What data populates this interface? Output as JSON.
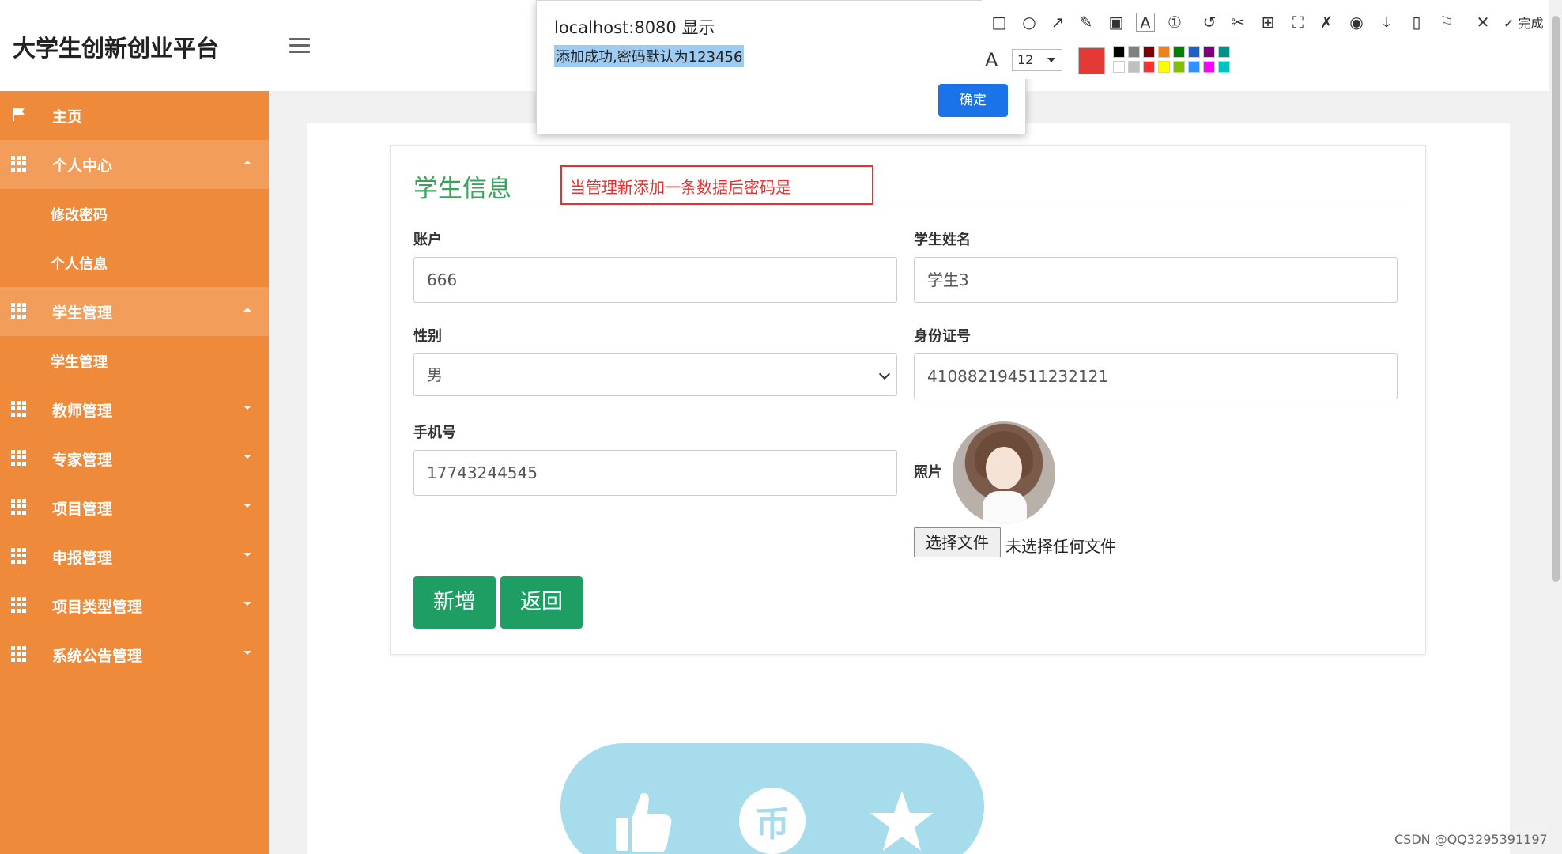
{
  "header": {
    "brand": "大学生创新创业平台",
    "avatar_text": "80x80"
  },
  "sidebar": {
    "items": [
      {
        "label": "主页",
        "icon": "flag-icon"
      },
      {
        "label": "个人中心",
        "icon": "grid-icon",
        "expanded": true
      },
      {
        "label": "修改密码",
        "sub": true
      },
      {
        "label": "个人信息",
        "sub": true
      },
      {
        "label": "学生管理",
        "icon": "grid-icon",
        "expanded": true
      },
      {
        "label": "学生管理",
        "sub": true
      },
      {
        "label": "教师管理",
        "icon": "grid-icon"
      },
      {
        "label": "专家管理",
        "icon": "grid-icon"
      },
      {
        "label": "项目管理",
        "icon": "grid-icon"
      },
      {
        "label": "申报管理",
        "icon": "grid-icon"
      },
      {
        "label": "项目类型管理",
        "icon": "grid-icon"
      },
      {
        "label": "系统公告管理",
        "icon": "grid-icon"
      }
    ]
  },
  "form": {
    "title": "学生信息",
    "annotation": "当管理新添加一条数据后密码是",
    "account_label": "账户",
    "account_value": "666",
    "name_label": "学生姓名",
    "name_value": "学生3",
    "gender_label": "性别",
    "gender_value": "男",
    "idcard_label": "身份证号",
    "idcard_value": "410882194511232121",
    "phone_label": "手机号",
    "phone_value": "17743244545",
    "photo_label": "照片",
    "file_button": "选择文件",
    "file_status": "未选择任何文件",
    "submit_label": "新增",
    "back_label": "返回"
  },
  "alert": {
    "title": "localhost:8080 显示",
    "message": "添加成功,密码默认为123456",
    "ok_label": "确定"
  },
  "toolbar": {
    "font_size": "12",
    "done_label": "完成",
    "current_color": "#e53935",
    "swatches": [
      "#000000",
      "#808080",
      "#800000",
      "#f08020",
      "#008000",
      "#2060c0",
      "#800080",
      "#009090",
      "#ffffff",
      "#c0c0c0",
      "#ff3030",
      "#ffff00",
      "#80c000",
      "#3090ff",
      "#ff00ff",
      "#00c0c0"
    ]
  },
  "watermark": "CSDN @QQ3295391197",
  "colors": {
    "sidebar": "#ee8a3a",
    "title": "#3aa35b",
    "primary_button": "#1e9e63",
    "dialog_button": "#1a73e8"
  }
}
